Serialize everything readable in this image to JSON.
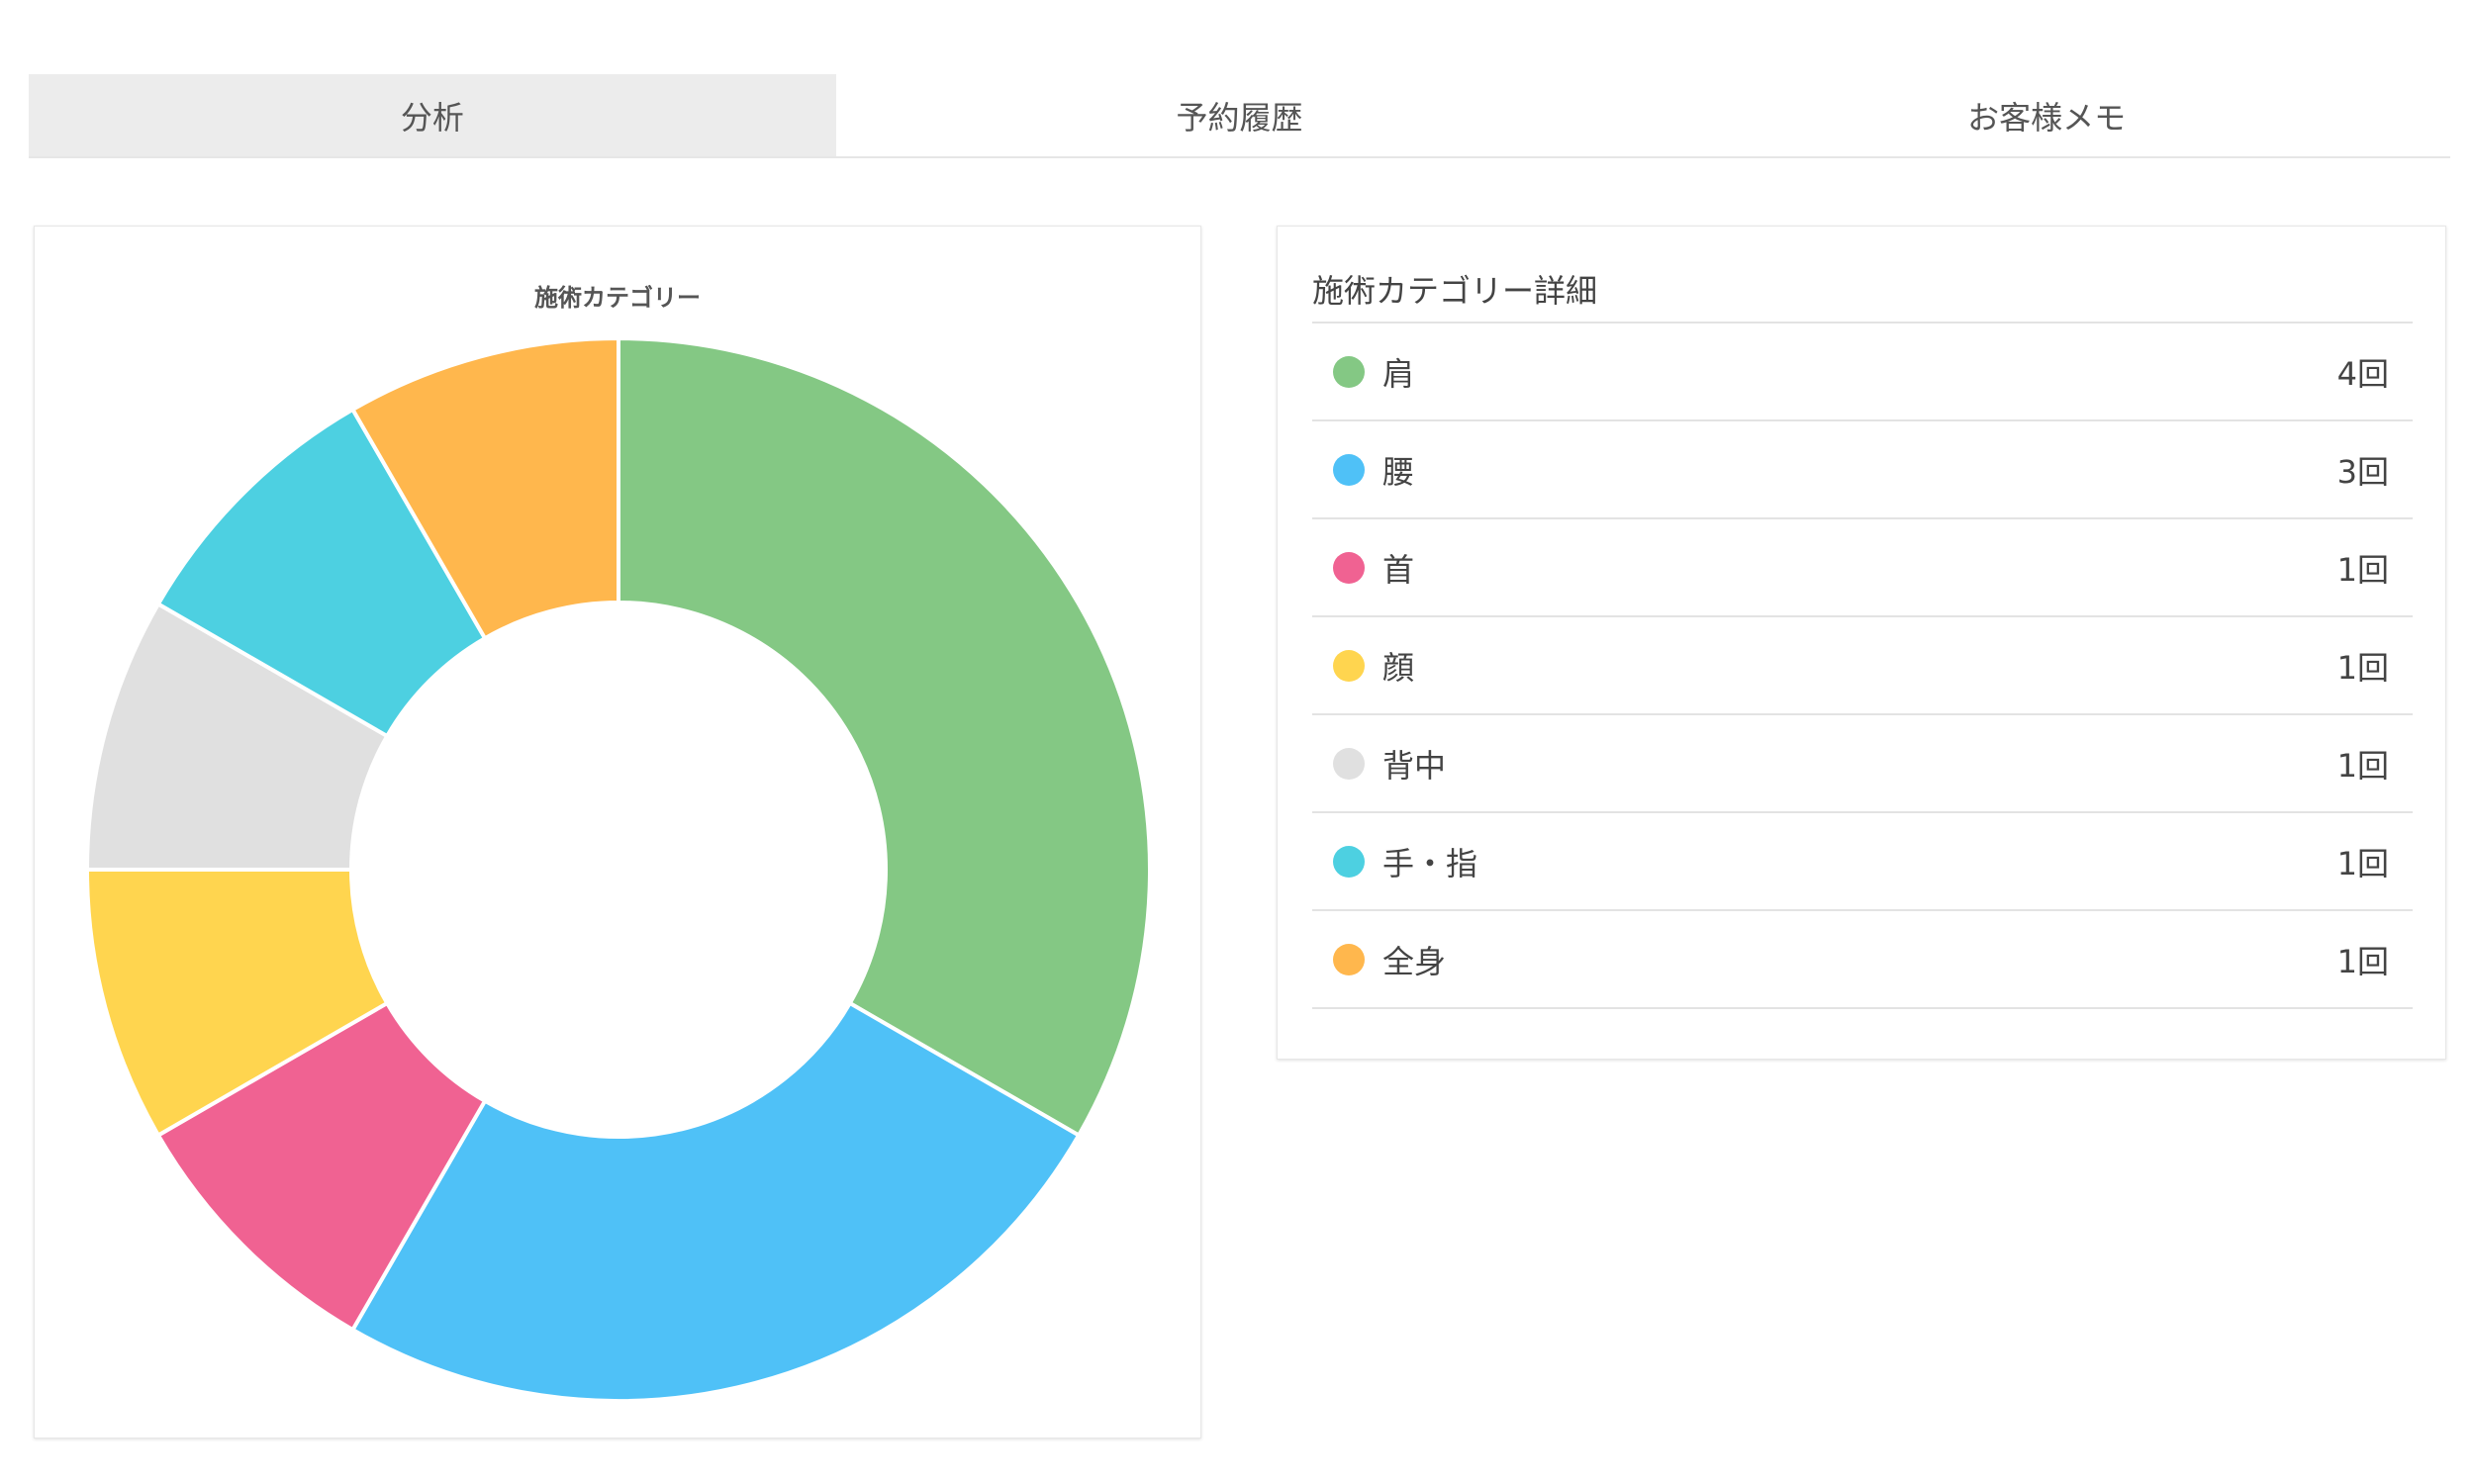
{
  "tabs": [
    {
      "label": "分析",
      "active": true
    },
    {
      "label": "予約履歴",
      "active": false
    },
    {
      "label": "お客様メモ",
      "active": false
    }
  ],
  "chart_card": {
    "title": "施術カテゴリー"
  },
  "chart_data": {
    "type": "pie",
    "title": "施術カテゴリー",
    "donut": true,
    "categories": [
      "肩",
      "腰",
      "首",
      "顔",
      "背中",
      "手・指",
      "全身"
    ],
    "values": [
      4,
      3,
      1,
      1,
      1,
      1,
      1
    ],
    "colors": [
      "#84c884",
      "#4fc1f7",
      "#f06292",
      "#ffd54f",
      "#e0e0e0",
      "#4dd0e1",
      "#ffb74d"
    ]
  },
  "detail": {
    "title": "施術カテゴリー詳細",
    "items": [
      {
        "label": "肩",
        "count": "4回",
        "color": "#84c884"
      },
      {
        "label": "腰",
        "count": "3回",
        "color": "#4fc1f7"
      },
      {
        "label": "首",
        "count": "1回",
        "color": "#f06292"
      },
      {
        "label": "顔",
        "count": "1回",
        "color": "#ffd54f"
      },
      {
        "label": "背中",
        "count": "1回",
        "color": "#e0e0e0"
      },
      {
        "label": "手・指",
        "count": "1回",
        "color": "#4dd0e1"
      },
      {
        "label": "全身",
        "count": "1回",
        "color": "#ffb74d"
      }
    ]
  }
}
